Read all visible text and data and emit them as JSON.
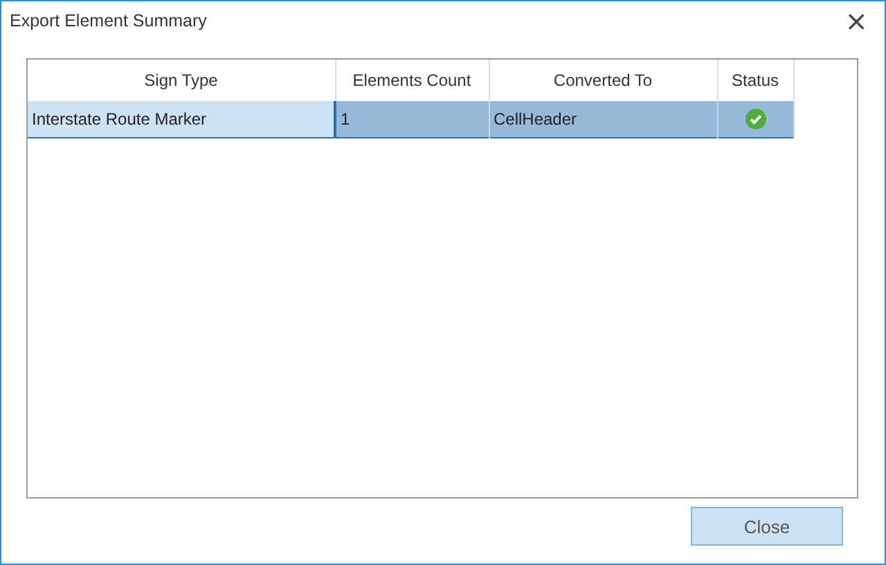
{
  "window": {
    "title": "Export Element Summary",
    "close": "×"
  },
  "table": {
    "columns": [
      "Sign Type",
      "Elements Count",
      "Converted To",
      "Status"
    ],
    "rows": [
      {
        "sign_type": "Interstate Route Marker",
        "elements_count": "1",
        "converted_to": "CellHeader",
        "succeeded": true,
        "selected": true
      }
    ]
  },
  "buttons": [
    "Close"
  ]
}
